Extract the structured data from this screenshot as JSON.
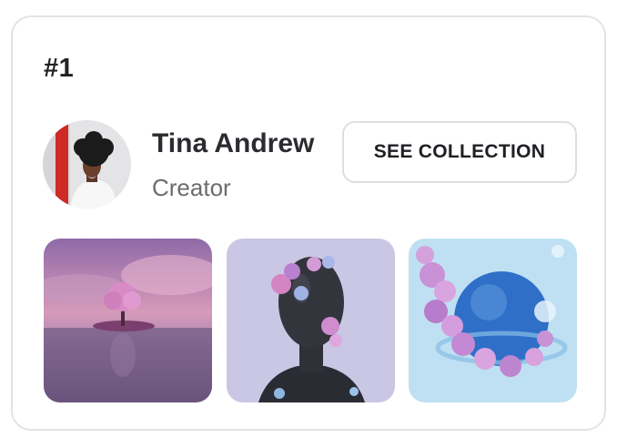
{
  "card": {
    "rank": "#1",
    "creator": {
      "name": "Tina Andrew",
      "role": "Creator",
      "avatar": "creator-avatar-photo"
    },
    "action": {
      "label": "SEE COLLECTION"
    },
    "collection": [
      {
        "name": "pink-tree-island-artwork"
      },
      {
        "name": "floral-head-sculpture-artwork"
      },
      {
        "name": "blue-sphere-flowers-artwork"
      }
    ]
  },
  "colors": {
    "border": "#e3e3e6",
    "text_primary": "#2b2b30",
    "text_secondary": "#6c6c70"
  }
}
